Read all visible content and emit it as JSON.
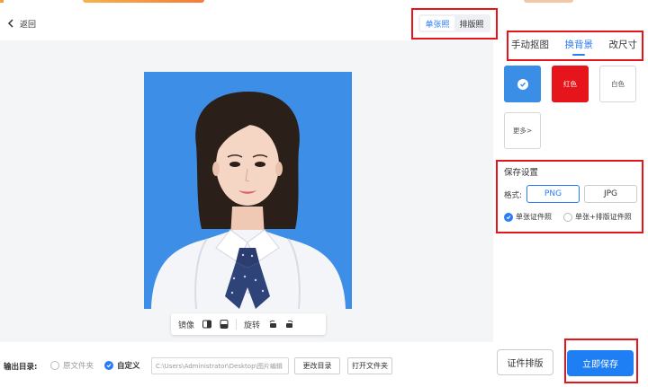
{
  "header": {
    "back_label": "返回"
  },
  "mode_toggle": {
    "single": "单张照",
    "layout": "排版照",
    "active": "single"
  },
  "tools": {
    "mirror_label": "镜像",
    "rotate_label": "旋转"
  },
  "panel_tabs": [
    {
      "label": "手动抠图",
      "active": false
    },
    {
      "label": "换背景",
      "active": true
    },
    {
      "label": "改尺寸",
      "active": false
    }
  ],
  "swatches": {
    "blue": {
      "color": "#3a8ee6",
      "selected": true
    },
    "red": {
      "label": "红色",
      "color": "#e6141b"
    },
    "white": {
      "label": "白色",
      "color": "#ffffff"
    },
    "more": {
      "label": "更多>"
    }
  },
  "save_settings": {
    "title": "保存设置",
    "format_label": "格式:",
    "formats": [
      "PNG",
      "JPG"
    ],
    "selected_format": "PNG",
    "options": [
      {
        "label": "单张证件照",
        "selected": true
      },
      {
        "label": "单张+排版证件照",
        "selected": false
      }
    ]
  },
  "output": {
    "label": "输出目录:",
    "original_folder": "原文件夹",
    "custom": "自定义",
    "selected": "custom",
    "path": "C:\\Users\\Administrator\\Desktop\\图片编辑",
    "change_dir": "更改目录",
    "open_folder": "打开文件夹"
  },
  "actions": {
    "layout_button": "证件排版",
    "save_button": "立即保存"
  },
  "colors": {
    "accent": "#2a7bf6",
    "highlight_box": "#e8141b",
    "photo_background": "#3d8ee6"
  }
}
